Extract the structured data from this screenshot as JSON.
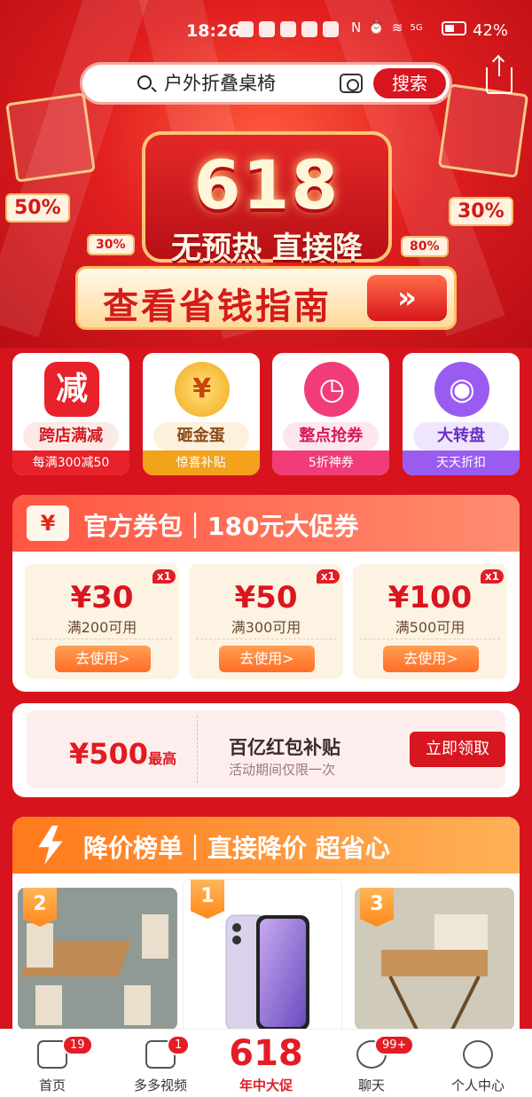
{
  "status": {
    "time": "18:26",
    "battery": "42%",
    "signal": "5G"
  },
  "search": {
    "value": "户外折叠桌椅",
    "button": "搜索"
  },
  "hero": {
    "big": "618",
    "subtitle": "无预热 直接降",
    "tag_left": "50%",
    "tag_left_small": "30%",
    "tag_right": "30%",
    "tag_right_small": "80%",
    "guide": "查看省钱指南"
  },
  "activities": [
    {
      "icon_text": "减",
      "name": "跨店满减",
      "sub": "每满300减50",
      "color": "#e8212a"
    },
    {
      "icon_text": "¥",
      "name": "砸金蛋",
      "sub": "惊喜补贴",
      "color": "#f2a21b"
    },
    {
      "icon_text": "◷",
      "name": "整点抢券",
      "sub": "5折神券",
      "color": "#f23c77"
    },
    {
      "icon_text": "◉",
      "name": "大转盘",
      "sub": "天天折扣",
      "color": "#9a5cf0"
    }
  ],
  "coupons": {
    "icon": "¥",
    "title": "官方券包｜180元大促券",
    "items": [
      {
        "amount": "¥30",
        "cond": "满200可用",
        "qty": "x1",
        "btn": "去使用>"
      },
      {
        "amount": "¥50",
        "cond": "满300可用",
        "qty": "x1",
        "btn": "去使用>"
      },
      {
        "amount": "¥100",
        "cond": "满500可用",
        "qty": "x1",
        "btn": "去使用>"
      }
    ]
  },
  "packet": {
    "amount": "¥500",
    "amount_suffix": "最高",
    "title": "百亿红包补贴",
    "sub": "活动期间仅限一次",
    "button": "立即领取"
  },
  "rank": {
    "title": "降价榜单｜直接降价 超省心",
    "products": [
      {
        "badge": "2"
      },
      {
        "badge": "1"
      },
      {
        "badge": "3"
      }
    ]
  },
  "nav": [
    {
      "label": "首页",
      "badge": "19"
    },
    {
      "label": "多多视频",
      "badge": "1"
    },
    {
      "label": "年中大促",
      "badge": "",
      "big": "618"
    },
    {
      "label": "聊天",
      "badge": "99+"
    },
    {
      "label": "个人中心",
      "badge": ""
    }
  ]
}
